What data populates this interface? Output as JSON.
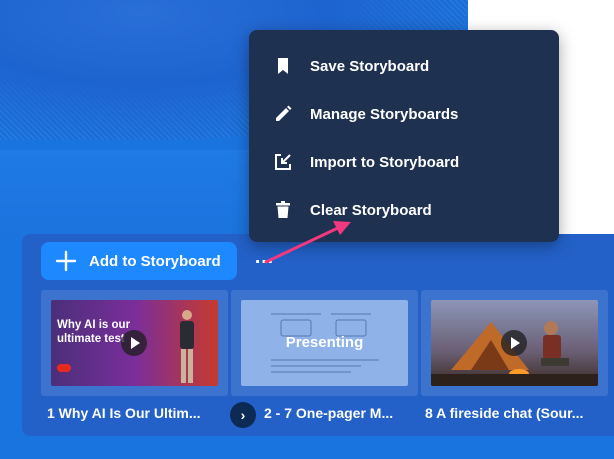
{
  "storyboard": {
    "add_label": "Add to Storyboard",
    "more_label": "…",
    "items": [
      {
        "index": "1",
        "caption": "1 Why AI Is Our Ultim...",
        "thumb_text": "Why AI is our ultimate test",
        "badge": "TED"
      },
      {
        "index": "2-7",
        "caption": "2 - 7 One-pager M...",
        "thumb_text": "Presenting"
      },
      {
        "index": "8",
        "caption": "8 A fireside chat (Sour..."
      }
    ],
    "next_arrow": "›"
  },
  "menu": {
    "items": [
      {
        "label": "Save Storyboard",
        "icon": "bookmark-icon"
      },
      {
        "label": "Manage Storyboards",
        "icon": "pencil-icon"
      },
      {
        "label": "Import to Storyboard",
        "icon": "import-icon"
      },
      {
        "label": "Clear Storyboard",
        "icon": "trash-icon"
      }
    ]
  },
  "colors": {
    "background": "#1a74e0",
    "menu_bg": "#1f3150",
    "button_bg": "#1e88ff",
    "annotation_arrow": "#f0397f"
  }
}
